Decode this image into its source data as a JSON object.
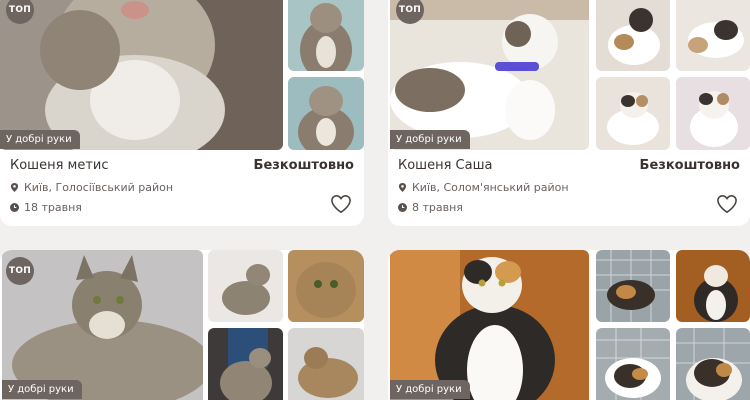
{
  "listings": [
    {
      "top_badge": "ТОП",
      "availability_badge": "У добрі руки",
      "title": "Кошеня метис",
      "price": "Безкоштовно",
      "location": "Київ, Голосіївський район",
      "date": "18 травня"
    },
    {
      "top_badge": "ТОП",
      "availability_badge": "У добрі руки",
      "title": "Кошеня Саша",
      "price": "Безкоштовно",
      "location": "Київ, Солом'янський район",
      "date": "8 травня"
    },
    {
      "top_badge": "ТОП",
      "availability_badge": "У добрі руки"
    },
    {
      "availability_badge": "У добрі руки"
    }
  ],
  "icons": {
    "location": "location-pin-icon",
    "date": "clock-icon",
    "favorite": "heart-outline-icon"
  },
  "colors": {
    "badge_bg": "#6e6460",
    "text_dark": "#3a3330",
    "text_muted": "#6a625e",
    "page_bg": "#f2f0ef"
  }
}
